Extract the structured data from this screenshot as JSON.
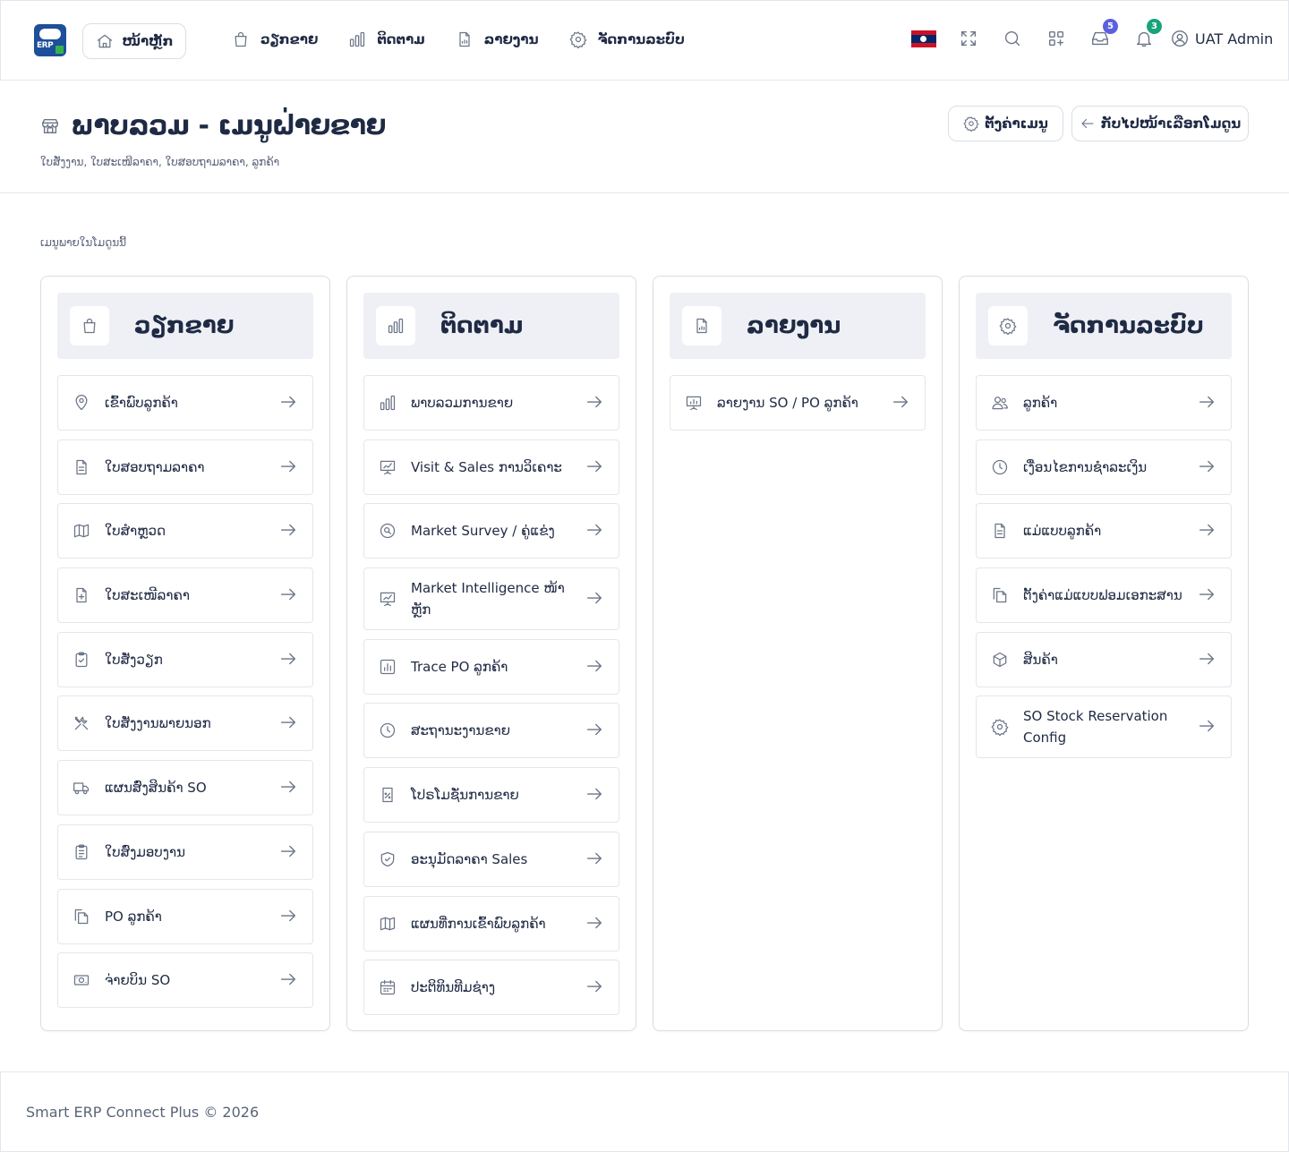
{
  "header": {
    "logo_text": "ERP",
    "home_label": "ໜ້າຫຼັກ",
    "nav": [
      {
        "label": "ວຽກຂາຍ",
        "icon": "bag-icon"
      },
      {
        "label": "ຕິດຕາມ",
        "icon": "bar-chart-icon"
      },
      {
        "label": "ລາຍງານ",
        "icon": "report-icon"
      },
      {
        "label": "ຈັດການລະບົບ",
        "icon": "gear-icon"
      }
    ],
    "language_flag": "laos-flag",
    "messages_count": "5",
    "notifications_count": "3",
    "user_name": "UAT Admin"
  },
  "page": {
    "title": "ພາບລວມ - ເມນູຝ່າຍຂາຍ",
    "subtitle": "ໃບສັ່ງງານ, ໃບສະເໜີລາຄາ, ໃບສອບຖາມລາຄາ, ລູກຄ້າ",
    "settings_button": "ຕັ້ງຄ່າເມນູ",
    "back_button": "ກັບໄປໜ້າເລືອກໂມດູນ",
    "section_label": "ເມນູພາຍໃນໂມດູນນີ້"
  },
  "columns": [
    {
      "title": "ວຽກຂາຍ",
      "icon": "bag-icon",
      "items": [
        {
          "label": "ເຂົ້າພົບລູກຄ້າ",
          "icon": "map-pin-icon"
        },
        {
          "label": "ໃບສອບຖາມລາຄາ",
          "icon": "document-icon"
        },
        {
          "label": "ໃບສຳຫຼວດ",
          "icon": "map-icon"
        },
        {
          "label": "ໃບສະເໜີລາຄາ",
          "icon": "file-plus-icon"
        },
        {
          "label": "ໃບສັ່ງວຽກ",
          "icon": "clipboard-check-icon"
        },
        {
          "label": "ໃບສັ່ງງານພາຍນອກ",
          "icon": "tools-icon"
        },
        {
          "label": "ແຜນສົ່ງສິນຄ້າ SO",
          "icon": "truck-icon"
        },
        {
          "label": "ໃບສົ່ງມອບງານ",
          "icon": "clipboard-list-icon"
        },
        {
          "label": "PO ລູກຄ້າ",
          "icon": "copy-icon"
        },
        {
          "label": "ຈ່າຍບິນ SO",
          "icon": "cash-icon"
        }
      ]
    },
    {
      "title": "ຕິດຕາມ",
      "icon": "bar-chart-icon",
      "items": [
        {
          "label": "ພາບລວມການຂາຍ",
          "icon": "bar-chart-icon"
        },
        {
          "label": "Visit & Sales ການວິເຄາະ",
          "icon": "presentation-chart-icon"
        },
        {
          "label": "Market Survey / ຄູ່ແຂ່ງ",
          "icon": "search-circle-icon"
        },
        {
          "label": "Market Intelligence ໜ້າຫຼັກ",
          "icon": "presentation-chart-icon"
        },
        {
          "label": "Trace PO ລູກຄ້າ",
          "icon": "report-bars-icon"
        },
        {
          "label": "ສະຖານະງານຂາຍ",
          "icon": "clock-icon"
        },
        {
          "label": "ໂປຣໂມຊັ່ນການຂາຍ",
          "icon": "percent-file-icon"
        },
        {
          "label": "ອະນຸມັດລາຄາ Sales",
          "icon": "shield-check-icon"
        },
        {
          "label": "ແຜນທີ່ການເຂົ້າພົບລູກຄ້າ",
          "icon": "map-icon"
        },
        {
          "label": "ປະຕິທິນທີມຊ່າງ",
          "icon": "calendar-icon"
        }
      ]
    },
    {
      "title": "ລາຍງານ",
      "icon": "report-icon",
      "items": [
        {
          "label": "ລາຍງານ SO / PO ລູກຄ້າ",
          "icon": "presentation-chart-icon"
        }
      ]
    },
    {
      "title": "ຈັດການລະບົບ",
      "icon": "gear-icon",
      "items": [
        {
          "label": "ລູກຄ້າ",
          "icon": "users-icon"
        },
        {
          "label": "ເງື່ອນໄຂການຊຳລະເງິນ",
          "icon": "clock-icon"
        },
        {
          "label": "ແມ່ແບບລູກຄ້າ",
          "icon": "document-icon"
        },
        {
          "label": "ຕັ້ງຄ່າແມ່ແບບຟອມເອກະສານ",
          "icon": "copy-icon"
        },
        {
          "label": "ສິນຄ້າ",
          "icon": "box-icon"
        },
        {
          "label": "SO Stock Reservation Config",
          "icon": "gear-icon"
        }
      ]
    }
  ],
  "footer": {
    "text": "Smart ERP Connect Plus © 2026"
  }
}
